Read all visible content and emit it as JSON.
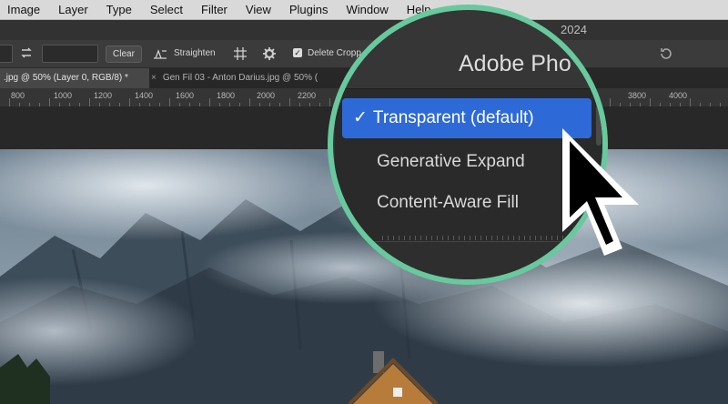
{
  "menubar": {
    "items": [
      "Image",
      "Layer",
      "Type",
      "Select",
      "Filter",
      "View",
      "Plugins",
      "Window",
      "Help"
    ]
  },
  "titlebar": {
    "year": "2024"
  },
  "options_bar": {
    "clear_label": "Clear",
    "straighten_label": "Straighten",
    "delete_cropped_label": "Delete Cropp"
  },
  "tabs": {
    "active": ".jpg @ 50% (Layer 0, RGB/8) *",
    "second": "Gen Fil 03 - Anton Darius.jpg @ 50% ("
  },
  "ruler": {
    "labels": [
      "800",
      "1000",
      "1200",
      "1400",
      "1600",
      "1800",
      "2000",
      "2200",
      "3800",
      "4000"
    ]
  },
  "magnifier": {
    "app_title": "Adobe Pho",
    "fill_menu": {
      "selected": "Transparent (default)",
      "options": [
        "Generative Expand",
        "Content-Aware Fill"
      ]
    }
  },
  "colors": {
    "accent_ring": "#67c99d",
    "selection_blue": "#2d6ad8"
  }
}
